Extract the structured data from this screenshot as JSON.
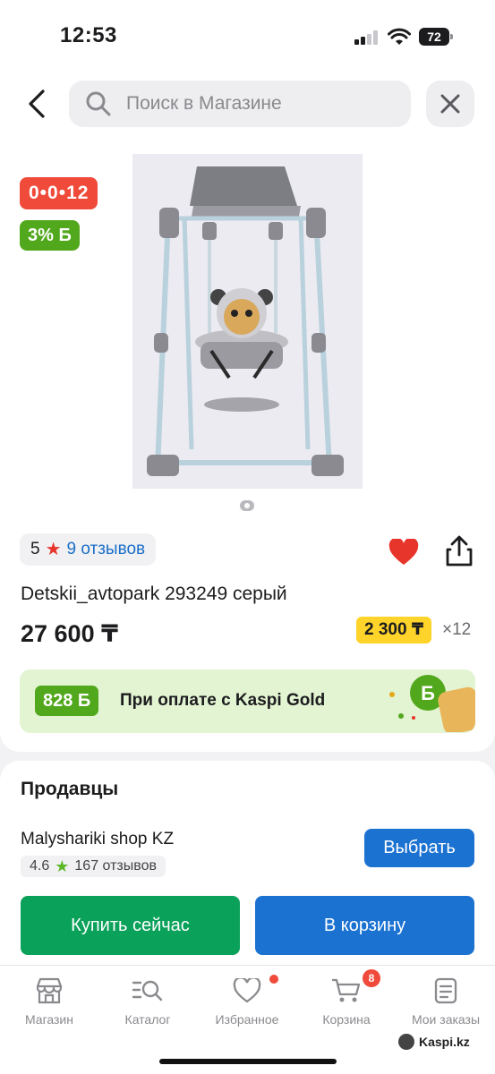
{
  "status": {
    "time": "12:53",
    "battery": "72"
  },
  "search": {
    "placeholder": "Поиск в Магазине"
  },
  "product": {
    "timer": "0•0•12",
    "bonus_percent": "3% Б",
    "rating": "5",
    "reviews": "9 отзывов",
    "title": "Detskii_avtopark 293249 серый",
    "price": "27 600 ₸",
    "installment": "2 300 ₸",
    "installment_months": "×12",
    "kaspi_gold_bonus": "828 Б",
    "kaspi_gold_text": "При оплате с Kaspi Gold",
    "favorite": true
  },
  "sellers": {
    "heading": "Продавцы",
    "shop_name": "Malyshariki shop KZ",
    "shop_rating": "4.6",
    "shop_reviews": "167 отзывов",
    "choose_label": "Выбрать",
    "buy_label": "Купить сейчас",
    "cart_label": "В корзину"
  },
  "tabs": [
    {
      "label": "Магазин",
      "icon": "shop-icon"
    },
    {
      "label": "Каталог",
      "icon": "catalog-icon"
    },
    {
      "label": "Избранное",
      "icon": "heart-icon"
    },
    {
      "label": "Корзина",
      "icon": "cart-icon",
      "badge": "8"
    },
    {
      "label": "Мои заказы",
      "icon": "orders-icon"
    }
  ],
  "watermark": "Kaspi.kz",
  "colors": {
    "accent_blue": "#1b72d1",
    "green": "#0aa15a",
    "red": "#f04a3a",
    "yellow": "#ffd42a"
  }
}
